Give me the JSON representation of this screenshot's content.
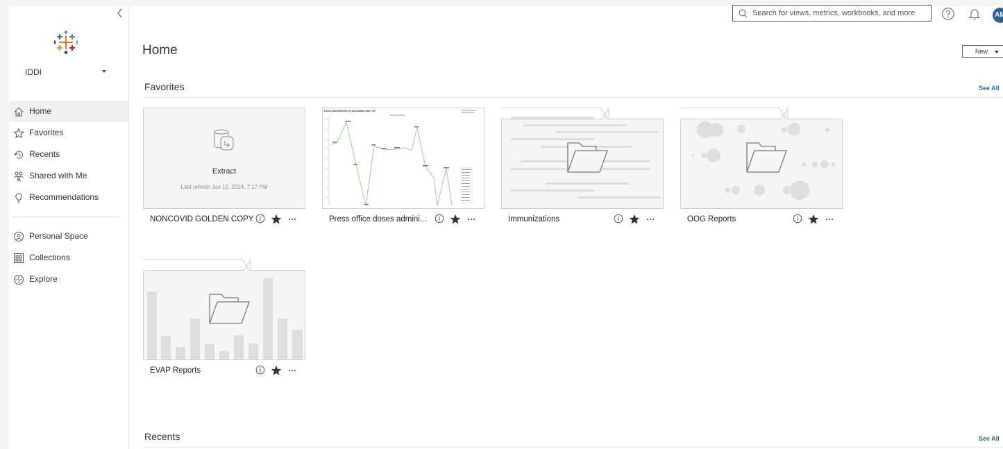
{
  "app": {
    "title": "Home",
    "user_initials": "AM"
  },
  "sidebar": {
    "site": "IDDI",
    "items": [
      {
        "label": "Home",
        "icon": "home-icon",
        "active": true
      },
      {
        "label": "Favorites",
        "icon": "star-outline-icon"
      },
      {
        "label": "Recents",
        "icon": "history-icon"
      },
      {
        "label": "Shared with Me",
        "icon": "shared-users-icon"
      },
      {
        "label": "Recommendations",
        "icon": "lightbulb-icon"
      }
    ],
    "items2": [
      {
        "label": "Personal Space",
        "icon": "personal-space-icon"
      },
      {
        "label": "Collections",
        "icon": "collections-icon"
      },
      {
        "label": "Explore",
        "icon": "explore-icon"
      }
    ]
  },
  "search": {
    "placeholder": "Search for views, metrics, workbooks, and more"
  },
  "header": {
    "new_label": "New"
  },
  "favorites": {
    "title": "Favorites",
    "see_all": "See All",
    "cards": [
      {
        "name": "NONCOVID GOLDEN COPY",
        "kind": "extract",
        "thumb_title": "Extract",
        "thumb_sub": "Last refresh Jun 15, 2024, 7:17 PM"
      },
      {
        "name": "Press office doses admini...",
        "kind": "view",
        "thumb_title": "Doses administered by vaccination date: 12+"
      },
      {
        "name": "Immunizations",
        "kind": "project"
      },
      {
        "name": "OOG Reports",
        "kind": "project"
      },
      {
        "name": "EVAP Reports",
        "kind": "project"
      }
    ]
  },
  "recents": {
    "title": "Recents",
    "see_all": "See All"
  },
  "colors": {
    "accent": "#2d6aa1",
    "avatar": "#2d5f91",
    "active_nav": "#f0f0f0",
    "chart_line": "#9bcf8e"
  }
}
